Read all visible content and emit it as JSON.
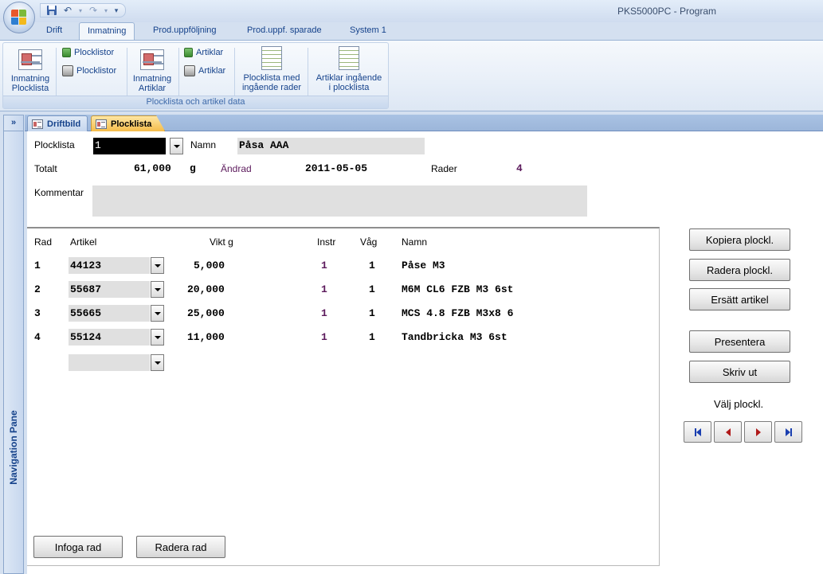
{
  "window": {
    "title": "PKS5000PC - Program"
  },
  "ribbon": {
    "tabs": [
      {
        "label": "Drift",
        "active": false
      },
      {
        "label": "Inmatning",
        "active": true
      },
      {
        "label": "Prod.uppföljning",
        "active": false
      },
      {
        "label": "Prod.uppf. sparade",
        "active": false
      },
      {
        "label": "System 1",
        "active": false
      }
    ],
    "group_label": "Plocklista och artikel data",
    "buttons": {
      "inmatning_plocklista": "Inmatning\nPlocklista",
      "plocklistor_1": "Plocklistor",
      "plocklistor_2": "Plocklistor",
      "inmatning_artiklar": "Inmatning\nArtiklar",
      "artiklar_1": "Artiklar",
      "artiklar_2": "Artiklar",
      "plocklista_med_rader": "Plocklista med\ningående rader",
      "artiklar_ingaende": "Artiklar ingående\ni plocklista"
    }
  },
  "navigation_pane": {
    "label": "Navigation Pane",
    "toggle": "»"
  },
  "document_tabs": [
    {
      "label": "Driftbild",
      "active": false
    },
    {
      "label": "Plocklista",
      "active": true
    }
  ],
  "form": {
    "plocklista_label": "Plocklista",
    "plocklista_value": "1",
    "namn_label": "Namn",
    "namn_value": "Påsa AAA",
    "totalt_label": "Totalt",
    "totalt_value": "61,000",
    "totalt_unit": "g",
    "andrad_label": "Ändrad",
    "andrad_value": "2011-05-05",
    "rader_label": "Rader",
    "rader_value": "4",
    "kommentar_label": "Kommentar",
    "kommentar_value": ""
  },
  "rows_table": {
    "headers": {
      "rad": "Rad",
      "artikel": "Artikel",
      "vikt": "Vikt g",
      "instr": "Instr",
      "vag": "Våg",
      "namn": "Namn"
    },
    "rows": [
      {
        "rad": "1",
        "artikel": "44123",
        "vikt": "5,000",
        "instr": "1",
        "vag": "1",
        "namn": "Påse M3"
      },
      {
        "rad": "2",
        "artikel": "55687",
        "vikt": "20,000",
        "instr": "1",
        "vag": "1",
        "namn": "M6M CL6 FZB M3 6st"
      },
      {
        "rad": "3",
        "artikel": "55665",
        "vikt": "25,000",
        "instr": "1",
        "vag": "1",
        "namn": "MCS 4.8 FZB M3x8 6"
      },
      {
        "rad": "4",
        "artikel": "55124",
        "vikt": "11,000",
        "instr": "1",
        "vag": "1",
        "namn": "Tandbricka M3 6st"
      }
    ],
    "new_row_artikel": ""
  },
  "buttons": {
    "kopiera": "Kopiera plockl.",
    "radera_plockl": "Radera plockl.",
    "ersatt": "Ersätt artikel",
    "presentera": "Presentera",
    "skriv_ut": "Skriv ut",
    "valj_label": "Välj plockl.",
    "infoga_rad": "Infoga rad",
    "radera_rad": "Radera rad"
  },
  "colors": {
    "ribbon_text": "#15428b",
    "active_tab": "#f5bc4a",
    "field_bg": "#e0e0e0",
    "purple_value": "#5c1a5c",
    "nav_arrow": "#b01a1a"
  }
}
